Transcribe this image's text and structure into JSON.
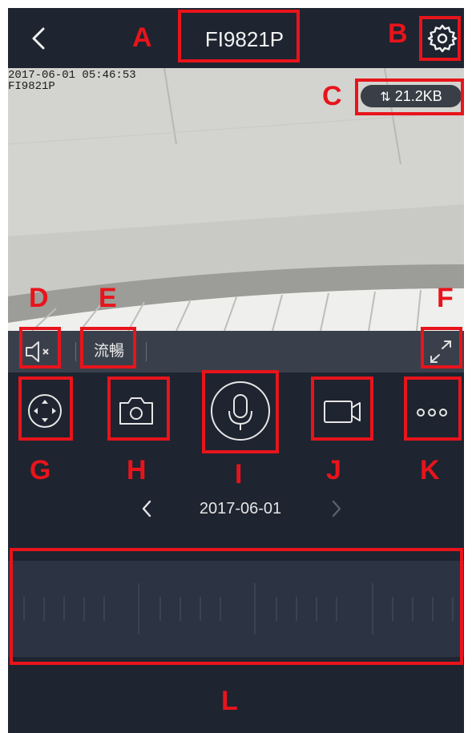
{
  "header": {
    "title": "FI9821P"
  },
  "video": {
    "osd_timestamp": "2017-06-01 05:46:53",
    "osd_camera": "FI9821P",
    "bitrate": "21.2KB"
  },
  "controls": {
    "quality_label": "流暢"
  },
  "timeline": {
    "date": "2017-06-01"
  },
  "markers": {
    "A": "A",
    "B": "B",
    "C": "C",
    "D": "D",
    "E": "E",
    "F": "F",
    "G": "G",
    "H": "H",
    "I": "I",
    "J": "J",
    "K": "K",
    "L": "L"
  },
  "colors": {
    "background": "#1e2430",
    "control_bar": "#3a404b",
    "timeline": "#2c3342",
    "annotation": "#e8141b"
  },
  "icons": [
    "back-arrow-icon",
    "settings-gear-icon",
    "bitrate-arrows-icon",
    "speaker-muted-icon",
    "fullscreen-icon",
    "ptz-direction-icon",
    "camera-snapshot-icon",
    "microphone-icon",
    "video-record-icon",
    "more-dots-icon",
    "prev-day-icon",
    "next-day-icon"
  ]
}
